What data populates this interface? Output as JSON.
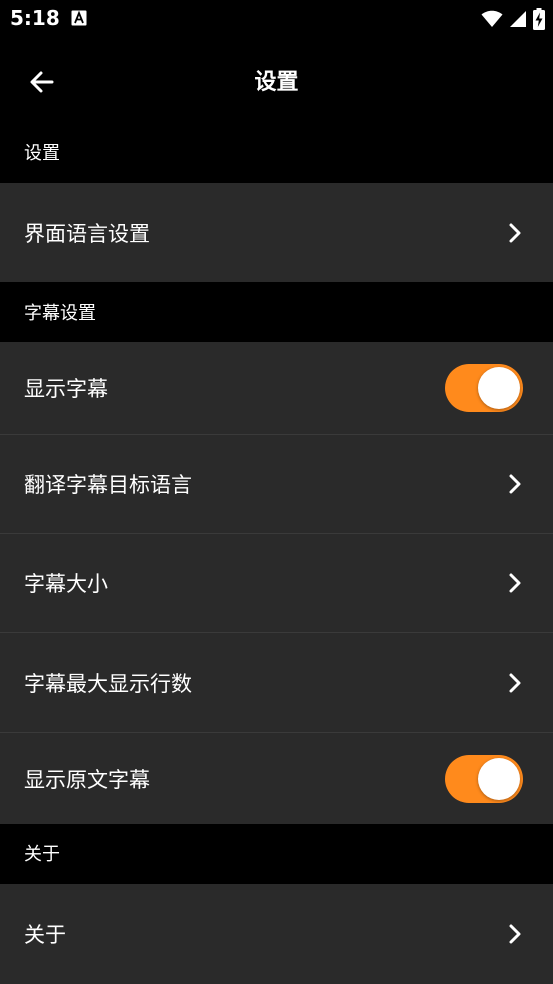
{
  "status_bar": {
    "time": "5:18",
    "notification_icon": "font-notification-icon",
    "wifi_icon": "wifi-icon",
    "signal_icon": "signal-icon",
    "battery_icon": "battery-charging-icon"
  },
  "app_bar": {
    "back_icon": "arrow-left-icon",
    "title": "设置"
  },
  "sections": {
    "settings": {
      "header": "设置",
      "interface_language": "界面语言设置"
    },
    "subtitle": {
      "header": "字幕设置",
      "show_subtitles": "显示字幕",
      "show_subtitles_on": true,
      "translate_target_language": "翻译字幕目标语言",
      "subtitle_size": "字幕大小",
      "max_lines": "字幕最大显示行数",
      "show_original": "显示原文字幕",
      "show_original_on": true
    },
    "about": {
      "header": "关于",
      "about_item": "关于"
    }
  },
  "colors": {
    "background": "#000000",
    "row_background": "#2a2a2a",
    "toggle_on": "#ff8a1c",
    "text": "#ffffff"
  }
}
